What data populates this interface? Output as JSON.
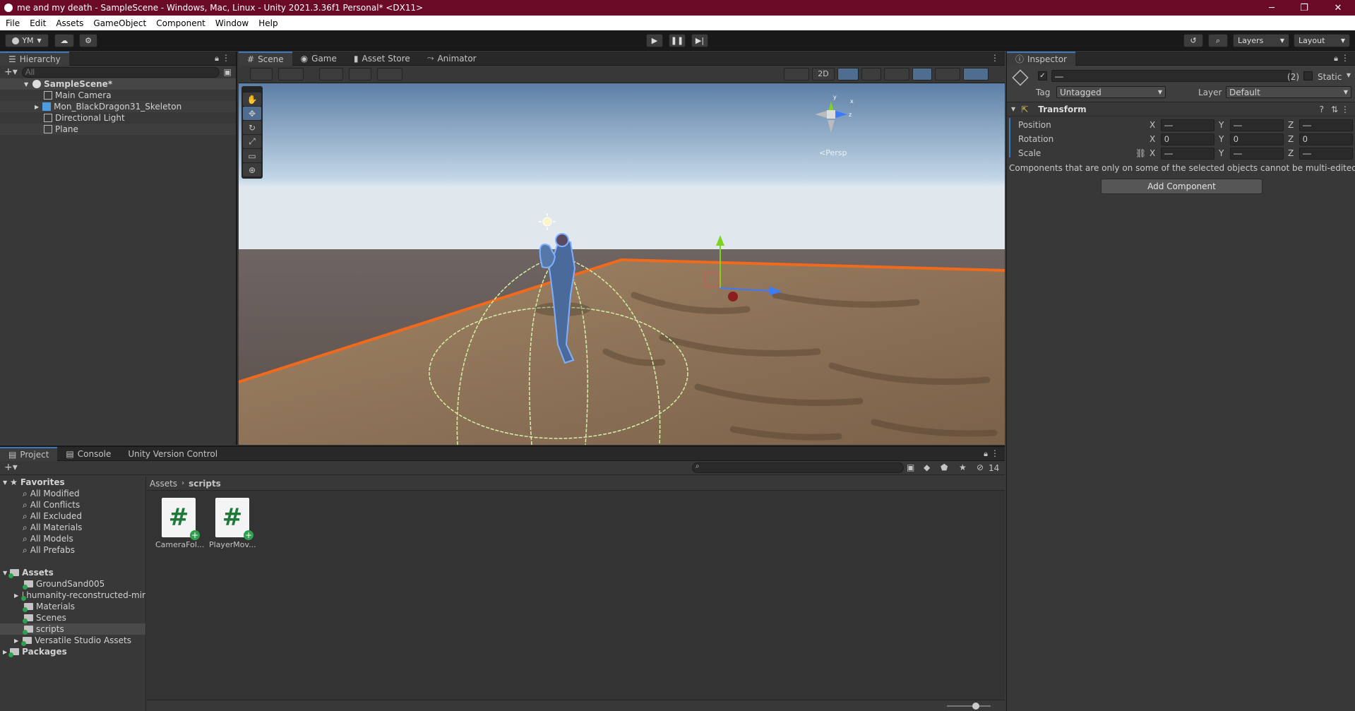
{
  "window": {
    "title": "me and my death - SampleScene - Windows, Mac, Linux - Unity 2021.3.36f1 Personal* <DX11>",
    "minimize": "─",
    "maximize": "❐",
    "close": "✕"
  },
  "menu": [
    "File",
    "Edit",
    "Assets",
    "GameObject",
    "Component",
    "Window",
    "Help"
  ],
  "toolbar": {
    "account": "YM",
    "layers": "Layers",
    "layout": "Layout"
  },
  "hierarchy": {
    "title": "Hierarchy",
    "search_placeholder": "All",
    "scene": "SampleScene*",
    "items": [
      "Main Camera",
      "Mon_BlackDragon31_Skeleton",
      "Directional Light",
      "Plane"
    ]
  },
  "scene_tabs": [
    "Scene",
    "Game",
    "Asset Store",
    "Animator"
  ],
  "scene_view": {
    "toggle_2d": "2D",
    "persp_label": "<Persp",
    "gizmo_axes": [
      "y",
      "z",
      "x"
    ]
  },
  "inspector": {
    "title": "Inspector",
    "name_value": "—",
    "count": "(2)",
    "static_label": "Static",
    "tag_label": "Tag",
    "tag_value": "Untagged",
    "layer_label": "Layer",
    "layer_value": "Default",
    "component": "Transform",
    "rows": [
      {
        "label": "Position",
        "x": "—",
        "y": "—",
        "z": "—"
      },
      {
        "label": "Rotation",
        "x": "0",
        "y": "0",
        "z": "0"
      },
      {
        "label": "Scale",
        "x": "—",
        "y": "—",
        "z": "—"
      }
    ],
    "axis_x": "X",
    "axis_y": "Y",
    "axis_z": "Z",
    "message": "Components that are only on some of the selected objects cannot be multi-edited.",
    "add_component": "Add Component"
  },
  "bottom_tabs": [
    "Project",
    "Console",
    "Unity Version Control"
  ],
  "project": {
    "favorites_label": "Favorites",
    "favorites": [
      "All Modified",
      "All Conflicts",
      "All Excluded",
      "All Materials",
      "All Models",
      "All Prefabs"
    ],
    "assets_label": "Assets",
    "assets": [
      "GroundSand005",
      "humanity-reconstructed-mir",
      "Materials",
      "Scenes",
      "scripts",
      "Versatile Studio Assets"
    ],
    "packages_label": "Packages",
    "breadcrumb": [
      "Assets",
      "scripts"
    ],
    "files": [
      "CameraFol...",
      "PlayerMov..."
    ],
    "hidden_count": "14"
  },
  "colors": {
    "title_bar": "#6b0a26",
    "accent": "#3a79bb",
    "selection_outline": "#f06a1e",
    "script_green": "#1f7a3a"
  }
}
